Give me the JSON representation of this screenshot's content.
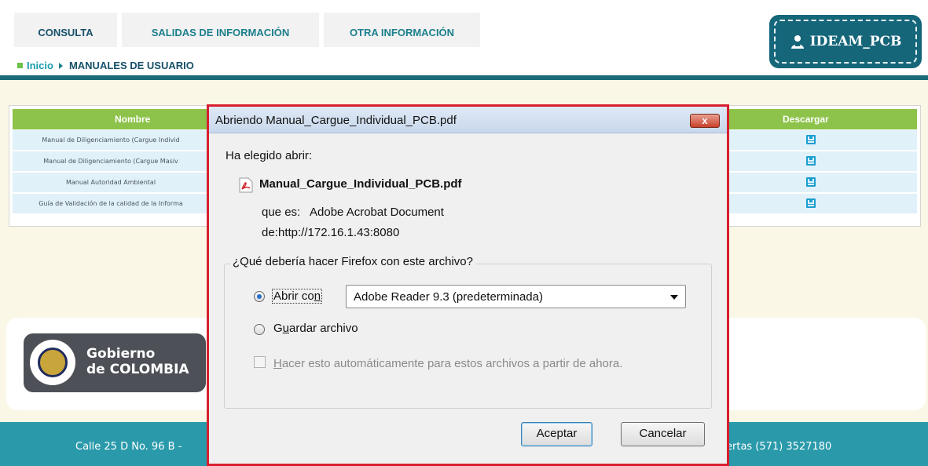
{
  "nav": {
    "tabs": [
      {
        "label": "CONSULTA"
      },
      {
        "label": "SALIDAS DE INFORMACIÓN"
      },
      {
        "label": "OTRA INFORMACIÓN"
      }
    ]
  },
  "breadcrumb": {
    "home": "Inicio",
    "current": "MANUALES DE USUARIO"
  },
  "user": {
    "name": "IDEAM_PCB",
    "icon": "user-icon"
  },
  "table": {
    "headers": {
      "nombre": "Nombre",
      "descargar": "Descargar"
    },
    "rows": [
      {
        "name": "Manual de Diligenciamiento (Cargue Individ"
      },
      {
        "name": "Manual de Diligenciamiento (Cargue Masiv"
      },
      {
        "name": "Manual Autoridad Ambiental"
      },
      {
        "name": "Guía de Validación de la calidad de la Informa"
      }
    ]
  },
  "footer": {
    "logo_line1": "Gobierno",
    "logo_line2": "de COLOMBIA",
    "address": "Calle 25 D No. 96 B -",
    "phone": "ertas (571) 3527180"
  },
  "dialog": {
    "title": "Abriendo Manual_Cargue_Individual_PCB.pdf",
    "close_label": "x",
    "intro": "Ha elegido abrir:",
    "file_name": "Manual_Cargue_Individual_PCB.pdf",
    "type_label": "que es:",
    "type_value": "Adobe Acrobat Document",
    "from_label": "de:",
    "from_value": "http://172.16.1.43:8080",
    "question": "¿Qué debería hacer Firefox con este archivo?",
    "open_with_a": "Abrir co",
    "open_with_b": "n",
    "app_selected": "Adobe Reader 9.3 (predeterminada)",
    "save_a": "G",
    "save_b": "u",
    "save_c": "ardar archivo",
    "auto_a": "H",
    "auto_b": "acer esto automáticamente para estos archivos a partir de ahora.",
    "accept": "Aceptar",
    "cancel": "Cancelar"
  },
  "colors": {
    "header_border": "#1a6a7a",
    "table_header": "#8dc34a",
    "row_bg": "#e1f1fa",
    "footer_bar": "#2a9aab",
    "dialog_border": "#d81f2f"
  }
}
